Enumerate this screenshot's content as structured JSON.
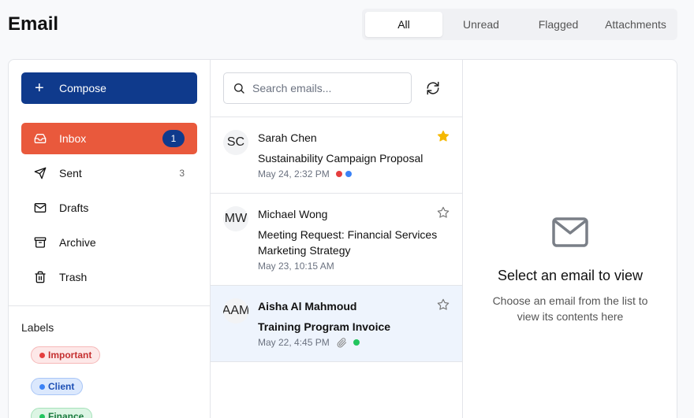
{
  "header": {
    "title": "Email"
  },
  "filters": [
    {
      "label": "All",
      "active": true
    },
    {
      "label": "Unread",
      "active": false
    },
    {
      "label": "Flagged",
      "active": false
    },
    {
      "label": "Attachments",
      "active": false
    }
  ],
  "sidebar": {
    "compose_label": "Compose",
    "items": [
      {
        "label": "Inbox",
        "icon": "inbox-icon",
        "count": "1",
        "active": true
      },
      {
        "label": "Sent",
        "icon": "send-icon",
        "count": "3",
        "active": false
      },
      {
        "label": "Drafts",
        "icon": "mail-icon",
        "count": "",
        "active": false
      },
      {
        "label": "Archive",
        "icon": "archive-icon",
        "count": "",
        "active": false
      },
      {
        "label": "Trash",
        "icon": "trash-icon",
        "count": "",
        "active": false
      }
    ],
    "labels_heading": "Labels",
    "labels": [
      {
        "name": "Important",
        "color": "#e53e3e",
        "bg": "#fde8e8",
        "text": "#c53030"
      },
      {
        "name": "Client",
        "color": "#3b82f6",
        "bg": "#dbe8fd",
        "text": "#1d4fb5"
      },
      {
        "name": "Finance",
        "color": "#22c55e",
        "bg": "#dcf5e4",
        "text": "#1a7a3e"
      }
    ]
  },
  "search": {
    "placeholder": "Search emails..."
  },
  "emails": [
    {
      "initials": "SC",
      "sender": "Sarah Chen",
      "subject": "Sustainability Campaign Proposal",
      "date": "May 24, 2:32 PM",
      "starred": true,
      "attachment": false,
      "selected": false,
      "label_colors": [
        "#e53e3e",
        "#3b82f6"
      ]
    },
    {
      "initials": "MW",
      "sender": "Michael Wong",
      "subject": "Meeting Request: Financial Services Marketing Strategy",
      "date": "May 23, 10:15 AM",
      "starred": false,
      "attachment": false,
      "selected": false,
      "label_colors": []
    },
    {
      "initials": "AAM",
      "sender": "Aisha Al Mahmoud",
      "subject": "Training Program Invoice",
      "date": "May 22, 4:45 PM",
      "starred": false,
      "attachment": true,
      "selected": true,
      "label_colors": [
        "#22c55e"
      ]
    }
  ],
  "viewer": {
    "title": "Select an email to view",
    "description": "Choose an email from the list to view its contents here"
  },
  "colors": {
    "accent": "#e9593c",
    "primary": "#0f3a8c",
    "star": "#f5b800"
  }
}
